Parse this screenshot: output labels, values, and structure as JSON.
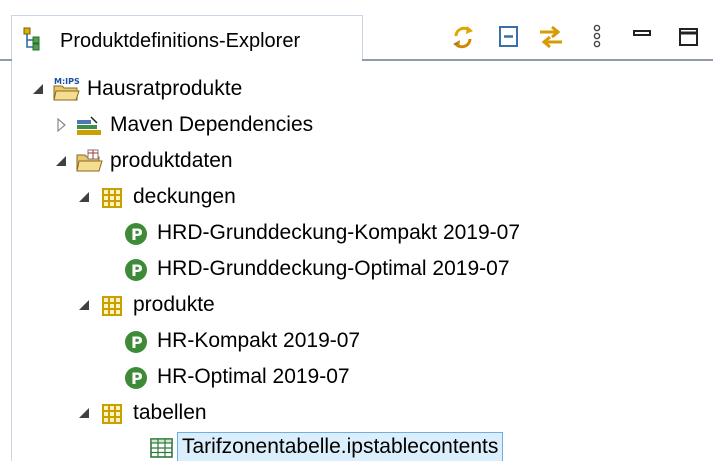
{
  "view": {
    "title": "Produktdefinitions-Explorer",
    "title_icon": "project-tree-icon",
    "toolbar": [
      {
        "name": "sync-icon",
        "tooltip": ""
      },
      {
        "name": "collapse-all-icon",
        "tooltip": ""
      },
      {
        "name": "link-with-editor-icon",
        "tooltip": ""
      },
      {
        "name": "view-menu-icon",
        "tooltip": ""
      },
      {
        "name": "minimize-icon",
        "tooltip": ""
      },
      {
        "name": "maximize-icon",
        "tooltip": ""
      }
    ]
  },
  "tree": {
    "items": [
      {
        "label": "Hausratprodukte",
        "icon": "ips-project-icon",
        "expanded": true
      },
      {
        "label": "Maven Dependencies",
        "icon": "library-icon",
        "expanded": false
      },
      {
        "label": "produktdaten",
        "icon": "open-folder-icon",
        "expanded": true
      },
      {
        "label": "deckungen",
        "icon": "package-icon",
        "expanded": true
      },
      {
        "label": "HRD-Grunddeckung-Kompakt 2019-07",
        "icon": "product-component-icon"
      },
      {
        "label": "HRD-Grunddeckung-Optimal 2019-07",
        "icon": "product-component-icon"
      },
      {
        "label": "produkte",
        "icon": "package-icon",
        "expanded": true
      },
      {
        "label": "HR-Kompakt 2019-07",
        "icon": "product-component-icon"
      },
      {
        "label": "HR-Optimal 2019-07",
        "icon": "product-component-icon"
      },
      {
        "label": "tabellen",
        "icon": "package-icon",
        "expanded": true
      },
      {
        "label": "Tarifzonentabelle.ipstablecontents",
        "icon": "table-contents-icon",
        "selected": true
      }
    ]
  },
  "colors": {
    "tree_twisty": "#404040",
    "package_icon": "#c9a000",
    "product_component_icon": "#3d8b37",
    "selection_bg": "#dbeefb",
    "selection_border": "#6fb0e3"
  }
}
